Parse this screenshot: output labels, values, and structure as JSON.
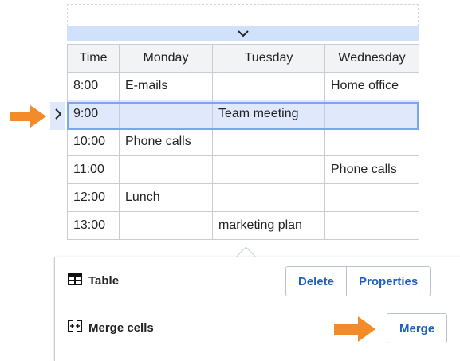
{
  "table": {
    "headers": [
      "Time",
      "Monday",
      "Tuesday",
      "Wednesday"
    ],
    "rows": [
      [
        "8:00",
        "E-mails",
        "",
        "Home office"
      ],
      [
        "9:00",
        "",
        "Team meeting",
        ""
      ],
      [
        "10:00",
        "Phone calls",
        "",
        ""
      ],
      [
        "11:00",
        "",
        "",
        "Phone calls"
      ],
      [
        "12:00",
        "Lunch",
        "",
        ""
      ],
      [
        "13:00",
        "",
        "marketing plan",
        ""
      ]
    ],
    "selected_row_index": 1
  },
  "panel": {
    "table_label": "Table",
    "delete_label": "Delete",
    "properties_label": "Properties",
    "merge_cells_label": "Merge cells",
    "merge_label": "Merge"
  },
  "colors": {
    "accent": "#1f5fbf",
    "selection": "#dfe9fb",
    "arrow": "#f28c2a"
  },
  "icons": [
    "chevron-down-icon",
    "chevron-right-icon",
    "table-icon",
    "merge-cells-icon",
    "arrow-right-icon"
  ]
}
